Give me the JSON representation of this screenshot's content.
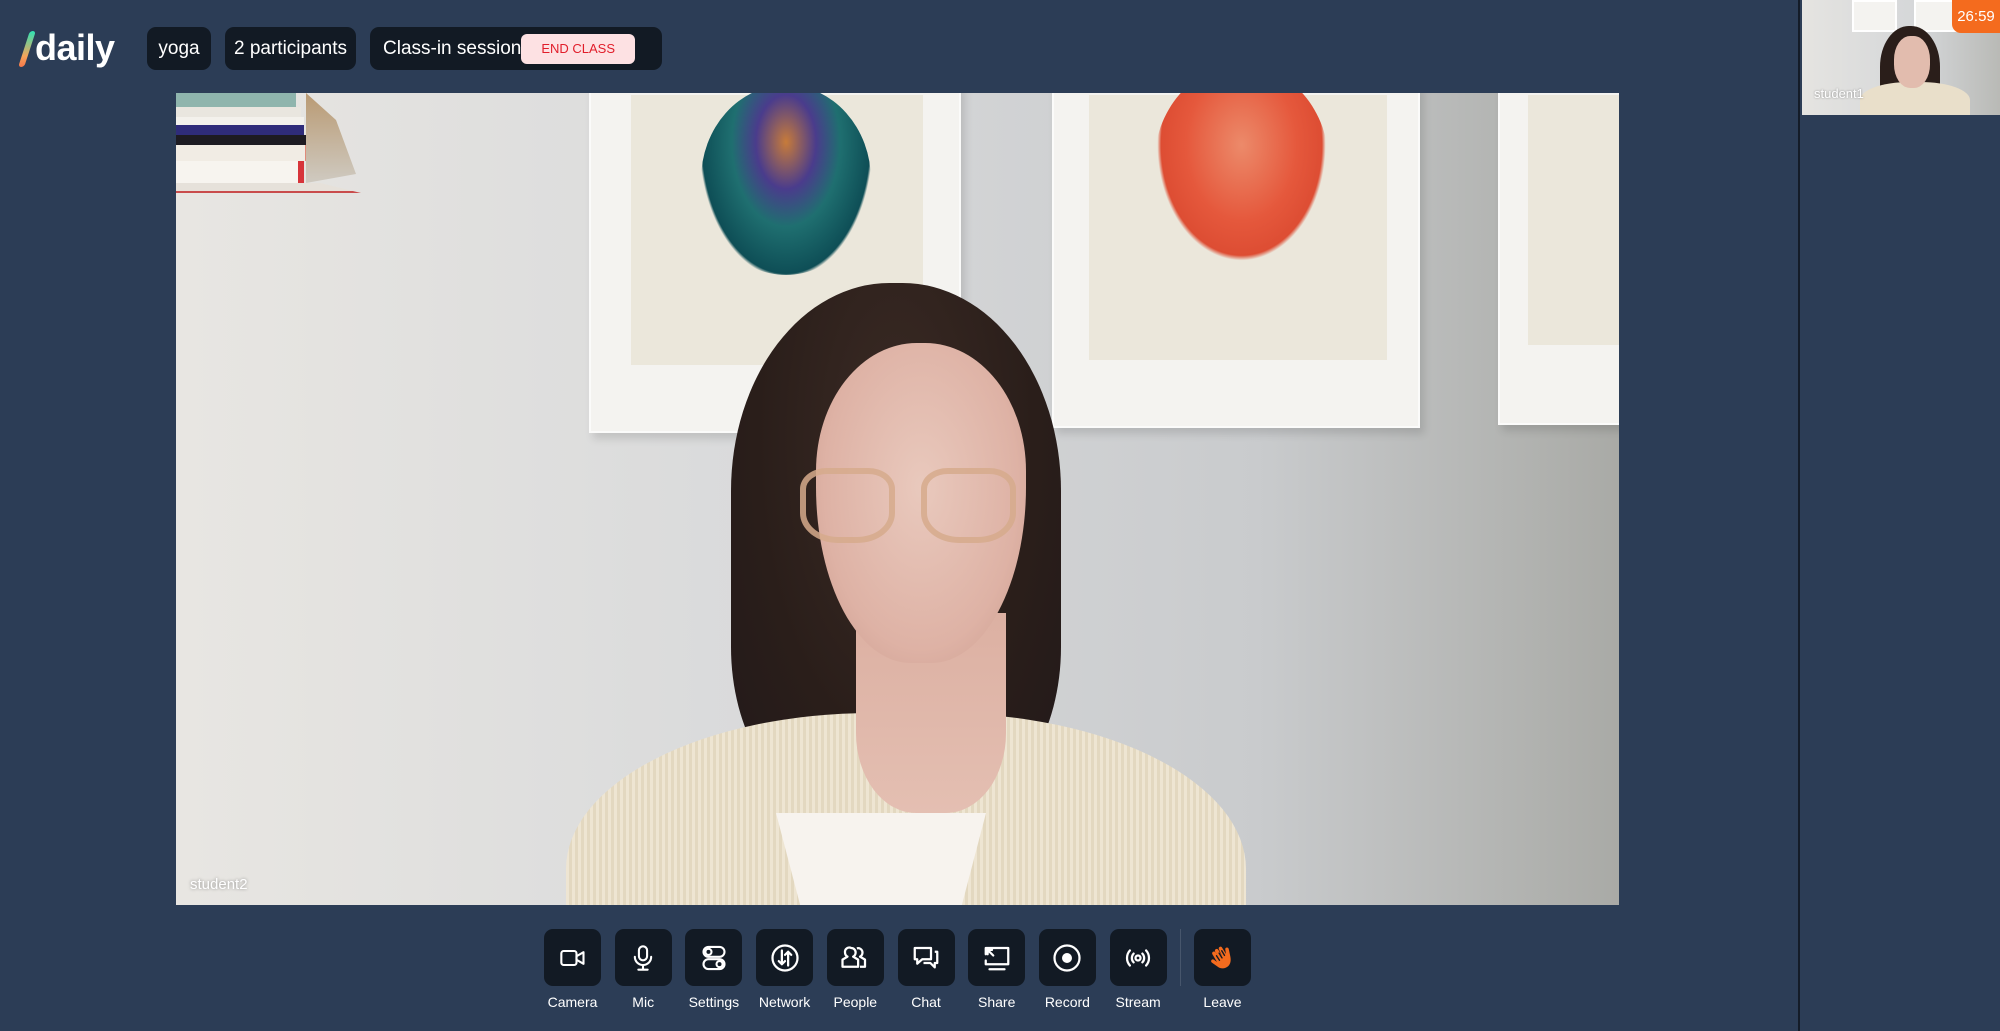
{
  "app": {
    "logo_text": "daily",
    "room_name": "yoga",
    "participant_count": "2 participants",
    "session_status": "Class-in session",
    "end_class_label": "END CLASS"
  },
  "colors": {
    "background": "#2c3d56",
    "pill": "#121a24",
    "end_class_bg": "#fde1e3",
    "end_class_text": "#e11d2a",
    "timer_bg": "#f46b1e",
    "leave_icon": "#f46b1e"
  },
  "main_video": {
    "participant_name": "student2"
  },
  "sidebar": {
    "thumbnails": [
      {
        "participant_name": "student1"
      }
    ],
    "timer": "26:59"
  },
  "tray": {
    "buttons": [
      {
        "label": "Camera",
        "icon": "camera-icon"
      },
      {
        "label": "Mic",
        "icon": "microphone-icon"
      },
      {
        "label": "Settings",
        "icon": "settings-toggle-icon"
      },
      {
        "label": "Network",
        "icon": "network-icon"
      },
      {
        "label": "People",
        "icon": "people-icon"
      },
      {
        "label": "Chat",
        "icon": "chat-icon"
      },
      {
        "label": "Share",
        "icon": "screen-share-icon"
      },
      {
        "label": "Record",
        "icon": "record-icon"
      },
      {
        "label": "Stream",
        "icon": "stream-icon"
      }
    ],
    "leave": {
      "label": "Leave",
      "icon": "waving-hand-icon"
    }
  }
}
